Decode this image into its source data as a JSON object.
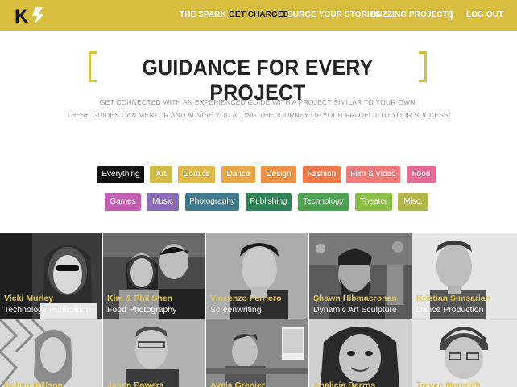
{
  "nav": {
    "logo_text": "K",
    "items": [
      {
        "label": "THE SPARK"
      },
      {
        "label": "GET CHARGED"
      },
      {
        "label": "SURGE YOUR STORIES"
      },
      {
        "label": "BUZZING PROJECTS"
      }
    ],
    "separator": "||",
    "logout": "LOG OUT"
  },
  "heading": "GUIDANCE FOR EVERY PROJECT",
  "subtitle": {
    "line1": "GET CONNECTED WITH AN EXPERIENCED GUIDE WITH A PROJECT SIMILAR TO YOUR OWN.",
    "line2": "THESE GUIDES CAN MENTOR AND ADVISE YOU ALONG THE JOURNEY OF YOUR PROJECT TO YOUR SUCCESS!"
  },
  "categories": {
    "row1": [
      {
        "label": "Everything",
        "color": "#111111"
      },
      {
        "label": "Art",
        "color": "#d2bc46"
      },
      {
        "label": "Comics",
        "color": "#dcb948"
      },
      {
        "label": "Dance",
        "color": "#e8a744"
      },
      {
        "label": "Design",
        "color": "#ec9145"
      },
      {
        "label": "Fashion",
        "color": "#ef7b4a"
      },
      {
        "label": "Film & Video",
        "color": "#f07a7a"
      },
      {
        "label": "Food",
        "color": "#e56b97"
      }
    ],
    "row2": [
      {
        "label": "Games",
        "color": "#c25fb0"
      },
      {
        "label": "Music",
        "color": "#8b6bb7"
      },
      {
        "label": "Photography",
        "color": "#3e7a8c"
      },
      {
        "label": "Publishing",
        "color": "#2e8255"
      },
      {
        "label": "Technology",
        "color": "#4ea353"
      },
      {
        "label": "Theater",
        "color": "#8bbf46"
      },
      {
        "label": "Misc.",
        "color": "#b3b648"
      }
    ]
  },
  "mentors": [
    {
      "name": "Vicki Murley",
      "role": "Technology Publication"
    },
    {
      "name": "Kim & Phil Shen",
      "role": "Food Photography"
    },
    {
      "name": "Vincenzo Ferriero",
      "role": "Screenwriting"
    },
    {
      "name": "Shawn Hibmacronan",
      "role": "Dynamic Art Sculpture"
    },
    {
      "name": "Kristian Simsarian",
      "role": "Dance Production"
    },
    {
      "name": "Robyn Willson",
      "role": ""
    },
    {
      "name": "Jason Powers",
      "role": ""
    },
    {
      "name": "Ayela Grenier",
      "role": ""
    },
    {
      "name": "Analicia Barros",
      "role": ""
    },
    {
      "name": "Trevce Meredith",
      "role": ""
    }
  ],
  "colors": {
    "brand": "#d7be3f",
    "name_text": "#e3c84a"
  }
}
